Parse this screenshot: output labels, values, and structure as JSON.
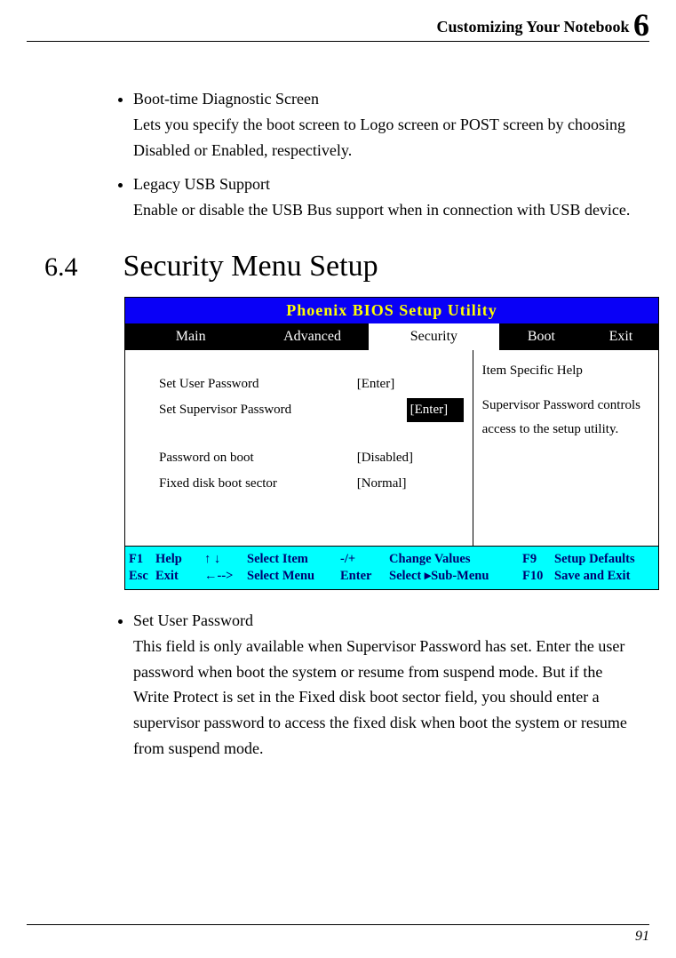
{
  "header": {
    "title": "Customizing Your Notebook",
    "chapter_number": "6"
  },
  "top_bullets": [
    {
      "title": "Boot-time Diagnostic Screen",
      "desc": "Lets you specify the boot screen to Logo screen or POST screen by choosing Disabled or Enabled, respectively."
    },
    {
      "title": "Legacy USB Support",
      "desc": "Enable or disable the USB Bus support when in connection with USB device."
    }
  ],
  "section": {
    "number": "6.4",
    "title": "Security Menu Setup"
  },
  "bios": {
    "title": "Phoenix BIOS Setup Utility",
    "tabs": {
      "main": "Main",
      "advanced": "Advanced",
      "security": "Security",
      "boot": "Boot",
      "exit": "Exit"
    },
    "options": [
      {
        "label": "Set User Password",
        "value": "[Enter]",
        "selected": false
      },
      {
        "label": "Set Supervisor Password",
        "value": "[Enter]",
        "selected": true
      },
      {
        "label": "Password on boot",
        "value": "[Disabled]",
        "selected": false
      },
      {
        "label": "Fixed disk boot sector",
        "value": "[Normal]",
        "selected": false
      }
    ],
    "help": {
      "title": "Item Specific Help",
      "text": "Supervisor Password controls access to the setup utility."
    },
    "footer": {
      "row1": {
        "k1": "F1",
        "l1": "Help",
        "arrows": "↑ ↓",
        "si": "Select Item",
        "k2": "-/+",
        "cv": "Change Values",
        "k3": "F9",
        "sd": "Setup Defaults"
      },
      "row2": {
        "k1": "Esc",
        "l1": "Exit",
        "arrows": "←-->",
        "si": "Select Menu",
        "k2": "Enter",
        "cv_a": "Select",
        "cv_b": "▸Sub-Menu",
        "k3": "F10",
        "sd": "Save and Exit"
      }
    }
  },
  "bottom_bullets": [
    {
      "title": "Set User Password",
      "desc": "This field is only available when Supervisor Password has set. Enter the user password when boot the system or resume from suspend mode. But if the Write Protect is set in the Fixed disk boot sector field, you should enter a supervisor password to access the fixed disk when boot the system or resume from suspend mode."
    }
  ],
  "page_number": "91"
}
